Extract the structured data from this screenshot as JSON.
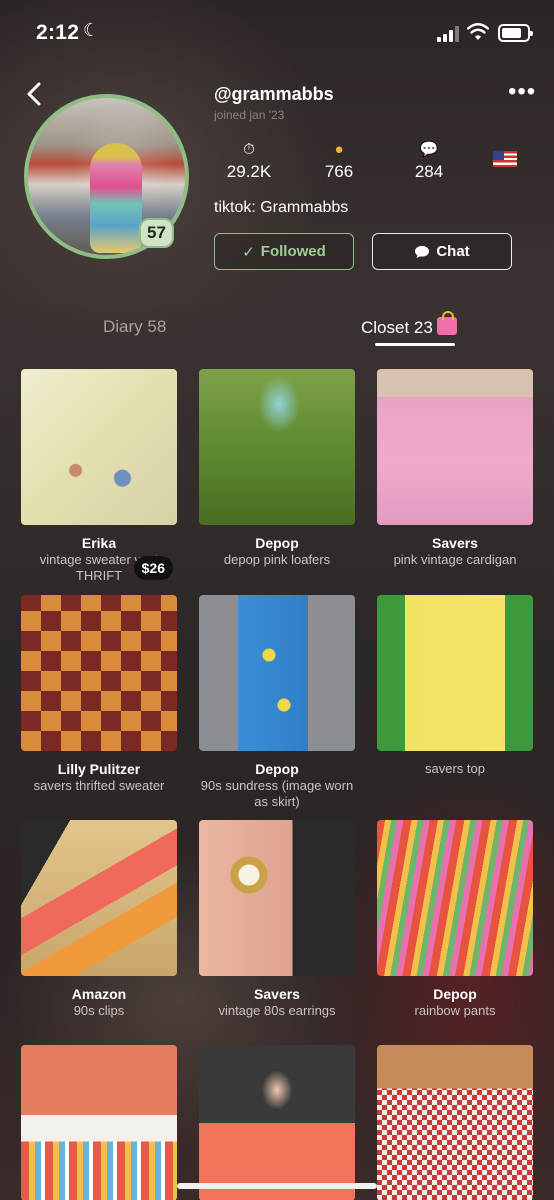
{
  "status_bar": {
    "time": "2:12"
  },
  "profile": {
    "username": "@grammabbs",
    "joined": "joined jan '23",
    "badge_count": "57",
    "stats": [
      {
        "icon": "stopwatch-icon",
        "value": "29.2K"
      },
      {
        "icon": "person-emoji-icon",
        "value": "766"
      },
      {
        "icon": "speech-bubble-icon",
        "value": "284"
      }
    ],
    "country_flag": "us-flag-icon",
    "tiktok": "tiktok: Grammabbs",
    "follow_label": "Followed",
    "chat_label": "Chat"
  },
  "tabs": {
    "diary": "Diary 58",
    "closet": "Closet 23"
  },
  "closet": [
    {
      "brand": "Erika",
      "desc": "vintage sweater vest THRIFT",
      "price": "$26"
    },
    {
      "brand": "Depop",
      "desc": "depop pink loafers"
    },
    {
      "brand": "Savers",
      "desc": "pink vintage cardigan"
    },
    {
      "brand": "Lilly Pulitzer",
      "desc": "savers thrifted sweater"
    },
    {
      "brand": "Depop",
      "desc": "90s sundress (image worn as skirt)"
    },
    {
      "brand": "",
      "desc": "savers top"
    },
    {
      "brand": "Amazon",
      "desc": "90s clips"
    },
    {
      "brand": "Savers",
      "desc": "vintage 80s earrings"
    },
    {
      "brand": "Depop",
      "desc": "rainbow pants"
    },
    {
      "brand": "",
      "desc": ""
    },
    {
      "brand": "",
      "desc": ""
    },
    {
      "brand": "",
      "desc": ""
    }
  ],
  "colors": {
    "accent_green": "#8fbd86",
    "background": "#2b2524"
  }
}
